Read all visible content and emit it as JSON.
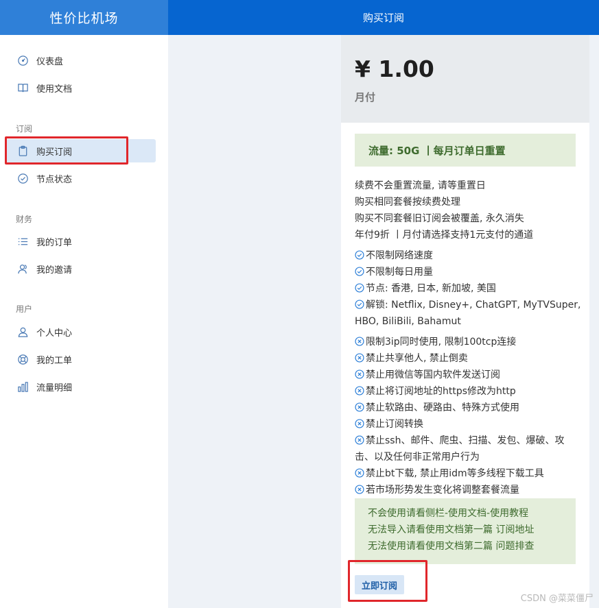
{
  "brand": "性价比机场",
  "page_title": "购买订阅",
  "sidebar": {
    "items": [
      {
        "label": "仪表盘",
        "icon": "gauge-icon"
      },
      {
        "label": "使用文档",
        "icon": "book-icon"
      },
      {
        "label": "购买订阅",
        "icon": "clipboard-icon",
        "active": true
      },
      {
        "label": "节点状态",
        "icon": "check-circle-icon"
      },
      {
        "label": "我的订单",
        "icon": "list-icon"
      },
      {
        "label": "我的邀请",
        "icon": "users-icon"
      },
      {
        "label": "个人中心",
        "icon": "user-icon"
      },
      {
        "label": "我的工单",
        "icon": "lifebuoy-icon"
      },
      {
        "label": "流量明细",
        "icon": "bar-chart-icon"
      }
    ],
    "sections": [
      "订阅",
      "财务",
      "用户"
    ]
  },
  "plan": {
    "price": "¥ 1.00",
    "period": "月付",
    "flow": "流量: 50G  丨每月订单日重置",
    "desc": [
      "续费不会重置流量, 请等重置日",
      "购买相同套餐按续费处理",
      "购买不同套餐旧订阅会被覆盖, 永久消失",
      "年付9折 丨月付请选择支持1元支付的通道"
    ],
    "allowed": [
      "不限制网络速度",
      "不限制每日用量",
      "节点: 香港, 日本, 新加坡, 美国",
      "解锁: Netflix, Disney+, ChatGPT, MyTVSuper, HBO, BiliBili, Bahamut"
    ],
    "forbidden": [
      "限制3ip同时使用, 限制100tcp连接",
      "禁止共享他人, 禁止倒卖",
      "禁止用微信等国内软件发送订阅",
      "禁止将订阅地址的https修改为http",
      "禁止软路由、硬路由、特殊方式使用",
      "禁止订阅转换",
      "禁止ssh、邮件、爬虫、扫描、发包、爆破、攻击、以及任何非正常用户行为",
      "禁止bt下载, 禁止用idm等多线程下载工具",
      "若市场形势发生变化将调整套餐流量"
    ],
    "help": [
      "不会使用请看侧栏-使用文档-使用教程",
      "无法导入请看使用文档第一篇 订阅地址",
      "无法使用请看使用文档第二篇 问题排查"
    ],
    "subscribe_label": "立即订阅"
  },
  "watermark": "CSDN @菜菜僵尸",
  "colors": {
    "brand_bg": "#2f80d8",
    "topbar_bg": "#0665d0",
    "highlight": "#e0262b",
    "green_box": "#e4eedb"
  }
}
